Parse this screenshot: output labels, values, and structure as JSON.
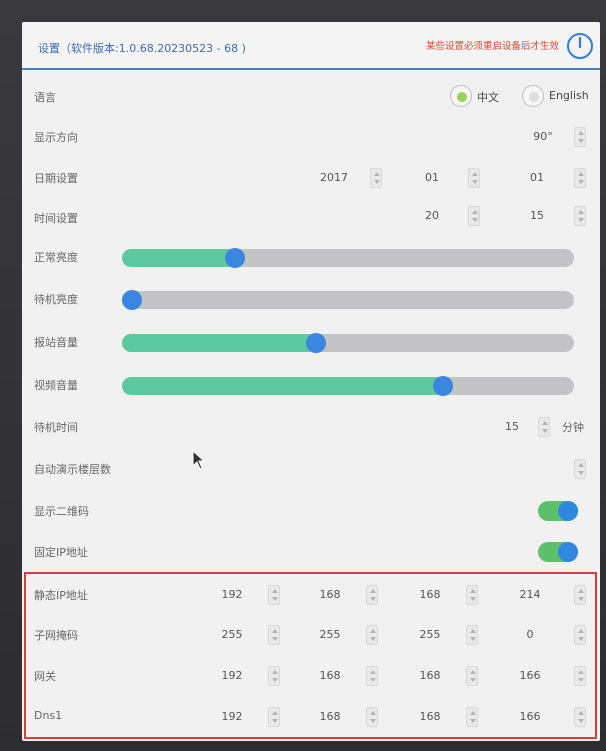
{
  "header": {
    "title": "设置（软件版本:1.0.68.20230523 - 68 )",
    "notice": "某些设置必须重启设备后才生效"
  },
  "language": {
    "label": "语言",
    "options": [
      {
        "label": "中文",
        "selected": true
      },
      {
        "label": "English",
        "selected": false
      }
    ]
  },
  "orientation": {
    "label": "显示方向",
    "value": "90°"
  },
  "date": {
    "label": "日期设置",
    "year": "2017",
    "month": "01",
    "day": "01"
  },
  "time": {
    "label": "时间设置",
    "hour": "20",
    "minute": "15"
  },
  "brightness_normal": {
    "label": "正常亮度",
    "level": 0.25
  },
  "brightness_standby": {
    "label": "待机亮度",
    "level": 0.0
  },
  "volume_announce": {
    "label": "报站音量",
    "level": 0.43
  },
  "volume_video": {
    "label": "视频音量",
    "level": 0.71
  },
  "standby_time": {
    "label": "待机时间",
    "value": "15",
    "unit": "分钟"
  },
  "demo_floors": {
    "label": "自动演示楼层数",
    "value": ""
  },
  "show_qr": {
    "label": "显示二维码",
    "on": true
  },
  "fixed_ip": {
    "label": "固定IP地址",
    "on": true
  },
  "static_ip": {
    "label": "静态IP地址",
    "octets": [
      "192",
      "168",
      "168",
      "214"
    ]
  },
  "subnet": {
    "label": "子网掩码",
    "octets": [
      "255",
      "255",
      "255",
      "0"
    ]
  },
  "gateway": {
    "label": "网关",
    "octets": [
      "192",
      "168",
      "168",
      "166"
    ]
  },
  "dns1": {
    "label": "Dns1",
    "octets": [
      "192",
      "168",
      "168",
      "166"
    ]
  },
  "colors": {
    "accent": "#3b86e0",
    "slider_fill": "#5cc9a0",
    "toggle_on": "#5dc06a",
    "notice": "#e0472e",
    "highlight": "#e03a3a"
  }
}
